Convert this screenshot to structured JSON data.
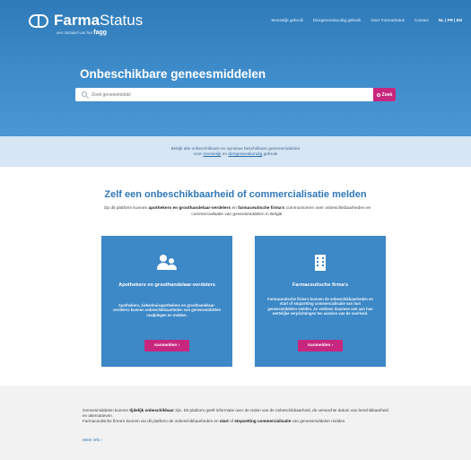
{
  "header": {
    "logo_prefix": "Farma",
    "logo_suffix": "Status",
    "logo_sub": "een initiatief van het",
    "logo_sub_brand": "fagg",
    "nav": [
      "Menselijk gebruik",
      "Diergeneeskundig gebruik",
      "Over FarmaStatus",
      "Contact"
    ],
    "languages": "NL | FR | EN"
  },
  "hero": {
    "title": "Onbeschikbare geneesmiddelen",
    "search_placeholder": "Zoek geneesmiddel",
    "search_button": "Zoek"
  },
  "info": {
    "line1": "Bekijk alle onbeschikbare en opnieuw beschikbare geneesmiddelen",
    "line2_pre": "voor",
    "link_human": "menselijk",
    "line2_mid": "en",
    "link_vet": "diergeneeskundig",
    "line2_post": "gebruik"
  },
  "report": {
    "title": "Zelf een onbeschikbaarheid of commercialisatie melden",
    "intro_1": "Op dit platform kunnen",
    "intro_b1": "apothekers en groothandelaar-verdelers",
    "intro_2": "en",
    "intro_b2": "farmaceutische firma's",
    "intro_3": "communiceren over onbeschikbaarheden en commercialisatie van geneesmiddelen in België."
  },
  "cards": [
    {
      "icon": "people-icon",
      "title": "Apothekers en groothandelaar-verdelers",
      "desc": "Apothekers, ziekenhuisapothekers en groothandelaar-verdelers kunnen onbeschikbaarheden van geneesmiddelen raadplegen en melden.",
      "button": "Aanmelden ›"
    },
    {
      "icon": "building-icon",
      "title": "Farmaceutische firma's",
      "desc": "Farmaceutische firma's kunnen de onbeschikbaarheden en start of stopzetting commercialisatie van hun geneesmiddelen melden. Zo voldoen daarmee ook aan hun wettelijke verplichtingen ten aanzien van de overheid.",
      "button": "Aanmelden ›"
    }
  ],
  "footer_info": {
    "t1": "Geneesmiddelen kunnen",
    "b1": "tijdelijk onbeschikbaar",
    "t2": "zijn. Dit platform geeft informatie over de reden van de onbeschikbaarheid, de verwachte datum van beschikbaarheid en alternatieven.",
    "t3": "Farmaceutische firma's kunnen via dit platform de onbeschikbaarheden en",
    "b2": "start",
    "t4": "of",
    "b3": "stopzetting commercialisatie",
    "t5": "van geneesmiddelen melden.",
    "more": "Meer info ›"
  },
  "colors": {
    "hero": "#3f8ccb",
    "accent": "#c8267e",
    "card": "#3d88c6",
    "title": "#2f78b7"
  }
}
